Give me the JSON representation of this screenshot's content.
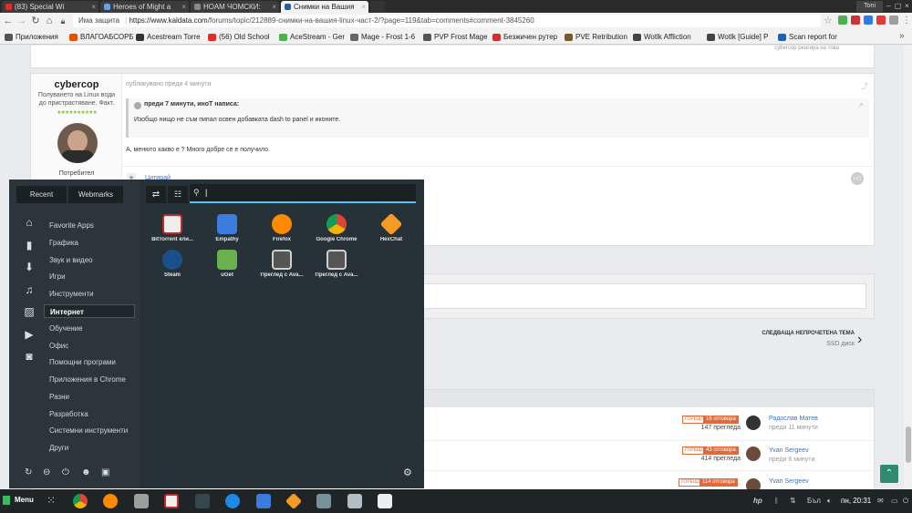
{
  "tabs": [
    {
      "label": "(83) Special Wi"
    },
    {
      "label": "Heroes of Might a"
    },
    {
      "label": "НОАМ ЧОМСКИ:"
    },
    {
      "label": "Снимки на Вашия"
    }
  ],
  "window": {
    "user": "Toni"
  },
  "address": {
    "security": "Има защита",
    "host": "https://www.kaldata.com",
    "path": "/forums/topic/212889-снимки-на-вашия-linux-част-2/?page=119&tab=comments#comment-3845260"
  },
  "bookmarks": [
    "Приложения",
    "ВЛАГОАБСОРБ",
    "Acestream Torre",
    "(56) Old School",
    "AceStream - Ger",
    "Mage - Frost 1-6",
    "PVP Frost Mage",
    "Безжичен рутер",
    "PVE Retribution",
    "Wotlk Affliction",
    "Wotlk [Guide] P",
    "Scan report for"
  ],
  "post": {
    "author": "cybercop",
    "author_title": "Полуването на Linux води до пристрастяване. Факт.",
    "stars": "★★★★★★★★★★",
    "role": "Потребител",
    "posted": "публикувано преди 4 минути",
    "quote_header": "преди 7 минути, иноТ написа:",
    "quote_text": "Изобщо нищо не съм пипал освен добавката dash to panel и иконите.",
    "body": "А, менюто какво е ? Много добре се е получило.",
    "quote_link": "Цитирай",
    "top_snip": "cybercop реагира на това"
  },
  "next_topic": {
    "label": "СЛЕДВАЩА НЕПРОЧЕТЕНА ТЕМА",
    "title": "SSD диск"
  },
  "topics": [
    {
      "hot": "ГОРЕЩО",
      "replies": "16 отговора",
      "views": "147 прегледа",
      "user": "Радослав Матев",
      "when": "преди 11 минути"
    },
    {
      "hot": "ГОРЕЩО",
      "replies": "43 отговора",
      "views": "414 прегледа",
      "user": "Yvan Sergeev",
      "when": "преди 6 минути"
    },
    {
      "hot": "ГОРЕЩО",
      "replies": "114 отговора",
      "views": "",
      "user": "Yvan Sergeev",
      "when": ""
    }
  ],
  "launcher": {
    "tabs": [
      "Recent",
      "Webmarks"
    ],
    "search_value": "|",
    "categories": [
      "Favorite Apps",
      "Графика",
      "Звук и видео",
      "Игри",
      "Инструменти",
      "Интернет",
      "Обучение",
      "Офис",
      "Помощни програми",
      "Приложения в Chrome",
      "Разни",
      "Разработка",
      "Системни инструменти",
      "Други"
    ],
    "selected": "Интернет",
    "apps": [
      {
        "label": "BitTorrent кли...",
        "color": "#e8e8e8"
      },
      {
        "label": "Empathy",
        "color": "#3b7ddd"
      },
      {
        "label": "Firefox",
        "color": "#ff8a00"
      },
      {
        "label": "Google Chrome",
        "color": "#4caf50"
      },
      {
        "label": "HexChat",
        "color": "#f59a23"
      },
      {
        "label": "Steam",
        "color": "#1b4f8a"
      },
      {
        "label": "uGet",
        "color": "#6ab04c"
      },
      {
        "label": "Преглед с Ava...",
        "color": "#cfcfcf"
      },
      {
        "label": "Преглед с Ava...",
        "color": "#cfcfcf"
      }
    ]
  },
  "taskbar": {
    "menu": "Menu",
    "lang": "Бъл",
    "clock": "пн, 20:31"
  }
}
